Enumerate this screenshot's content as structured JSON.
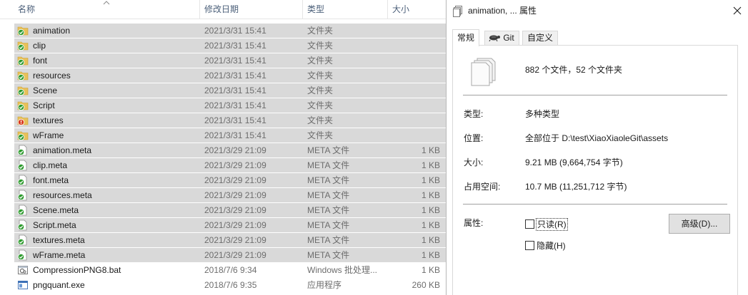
{
  "explorer": {
    "columns": {
      "name": "名称",
      "modified": "修改日期",
      "type": "类型",
      "size": "大小"
    },
    "rows": [
      {
        "name": "animation",
        "date": "2021/3/31 15:41",
        "type": "文件夹",
        "size": "",
        "icon": "folder-git-ok-icon",
        "selected": true
      },
      {
        "name": "clip",
        "date": "2021/3/31 15:41",
        "type": "文件夹",
        "size": "",
        "icon": "folder-git-ok-icon",
        "selected": true
      },
      {
        "name": "font",
        "date": "2021/3/31 15:41",
        "type": "文件夹",
        "size": "",
        "icon": "folder-git-ok-icon",
        "selected": true
      },
      {
        "name": "resources",
        "date": "2021/3/31 15:41",
        "type": "文件夹",
        "size": "",
        "icon": "folder-git-ok-icon",
        "selected": true
      },
      {
        "name": "Scene",
        "date": "2021/3/31 15:41",
        "type": "文件夹",
        "size": "",
        "icon": "folder-git-ok-icon",
        "selected": true
      },
      {
        "name": "Script",
        "date": "2021/3/31 15:41",
        "type": "文件夹",
        "size": "",
        "icon": "folder-git-ok-icon",
        "selected": true
      },
      {
        "name": "textures",
        "date": "2021/3/31 15:41",
        "type": "文件夹",
        "size": "",
        "icon": "folder-git-modified-icon",
        "selected": true
      },
      {
        "name": "wFrame",
        "date": "2021/3/31 15:41",
        "type": "文件夹",
        "size": "",
        "icon": "folder-git-ok-icon",
        "selected": true
      },
      {
        "name": "animation.meta",
        "date": "2021/3/29 21:09",
        "type": "META 文件",
        "size": "1 KB",
        "icon": "file-git-ok-icon",
        "selected": true
      },
      {
        "name": "clip.meta",
        "date": "2021/3/29 21:09",
        "type": "META 文件",
        "size": "1 KB",
        "icon": "file-git-ok-icon",
        "selected": true
      },
      {
        "name": "font.meta",
        "date": "2021/3/29 21:09",
        "type": "META 文件",
        "size": "1 KB",
        "icon": "file-git-ok-icon",
        "selected": true
      },
      {
        "name": "resources.meta",
        "date": "2021/3/29 21:09",
        "type": "META 文件",
        "size": "1 KB",
        "icon": "file-git-ok-icon",
        "selected": true
      },
      {
        "name": "Scene.meta",
        "date": "2021/3/29 21:09",
        "type": "META 文件",
        "size": "1 KB",
        "icon": "file-git-ok-icon",
        "selected": true
      },
      {
        "name": "Script.meta",
        "date": "2021/3/29 21:09",
        "type": "META 文件",
        "size": "1 KB",
        "icon": "file-git-ok-icon",
        "selected": true
      },
      {
        "name": "textures.meta",
        "date": "2021/3/29 21:09",
        "type": "META 文件",
        "size": "1 KB",
        "icon": "file-git-ok-icon",
        "selected": true
      },
      {
        "name": "wFrame.meta",
        "date": "2021/3/29 21:09",
        "type": "META 文件",
        "size": "1 KB",
        "icon": "file-git-ok-icon",
        "selected": true
      },
      {
        "name": "CompressionPNG8.bat",
        "date": "2018/7/6 9:34",
        "type": "Windows 批处理...",
        "size": "1 KB",
        "icon": "batch-file-icon",
        "selected": false
      },
      {
        "name": "pngquant.exe",
        "date": "2018/7/6 9:35",
        "type": "应用程序",
        "size": "260 KB",
        "icon": "exe-file-icon",
        "selected": false
      }
    ]
  },
  "dialog": {
    "title": "animation, ... 属性",
    "tabs": [
      {
        "label": "常规",
        "active": true
      },
      {
        "label": "Git",
        "active": false,
        "icon": "tortoise-git-icon"
      },
      {
        "label": "自定义",
        "active": false
      }
    ],
    "summary": "882 个文件，52 个文件夹",
    "props": {
      "type_label": "类型:",
      "type_value": "多种类型",
      "location_label": "位置:",
      "location_value": "全部位于 D:\\test\\XiaoXiaoleGit\\assets",
      "size_label": "大小:",
      "size_value": "9.21 MB (9,664,754 字节)",
      "disk_label": "占用空间:",
      "disk_value": "10.7 MB (11,251,712 字节)"
    },
    "attributes": {
      "label": "属性:",
      "readonly": "只读(R)",
      "hidden": "隐藏(H)",
      "advanced": "高级(D)..."
    }
  }
}
